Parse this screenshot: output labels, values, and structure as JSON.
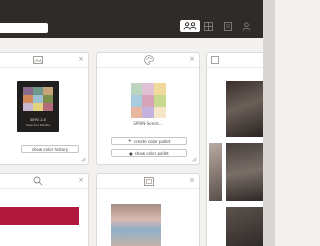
{
  "header": {
    "search": {
      "value": "",
      "placeholder": ""
    },
    "buttons": [
      {
        "icon": "people-icon"
      },
      {
        "icon": "grid-icon"
      },
      {
        "icon": "document-icon"
      },
      {
        "icon": "user-icon"
      }
    ]
  },
  "cards": {
    "history_board": {
      "icon": "image-icon",
      "swatch_title": "SEYO 2.0",
      "swatch_subtitle": "Selected Palette",
      "button_label": "show color history"
    },
    "palette": {
      "icon": "palette-icon",
      "thumbnail_label": "SPRIN-Seeds...",
      "button1_label": "create color pallet",
      "button2_label": "show color pallet"
    },
    "search": {
      "icon": "search-icon"
    },
    "photo": {
      "icon": "photo-icon"
    }
  },
  "colors": {
    "header_bg": "#2f2b28",
    "accent_crimson": "#b0183e",
    "card_border": "#dcdad6"
  }
}
